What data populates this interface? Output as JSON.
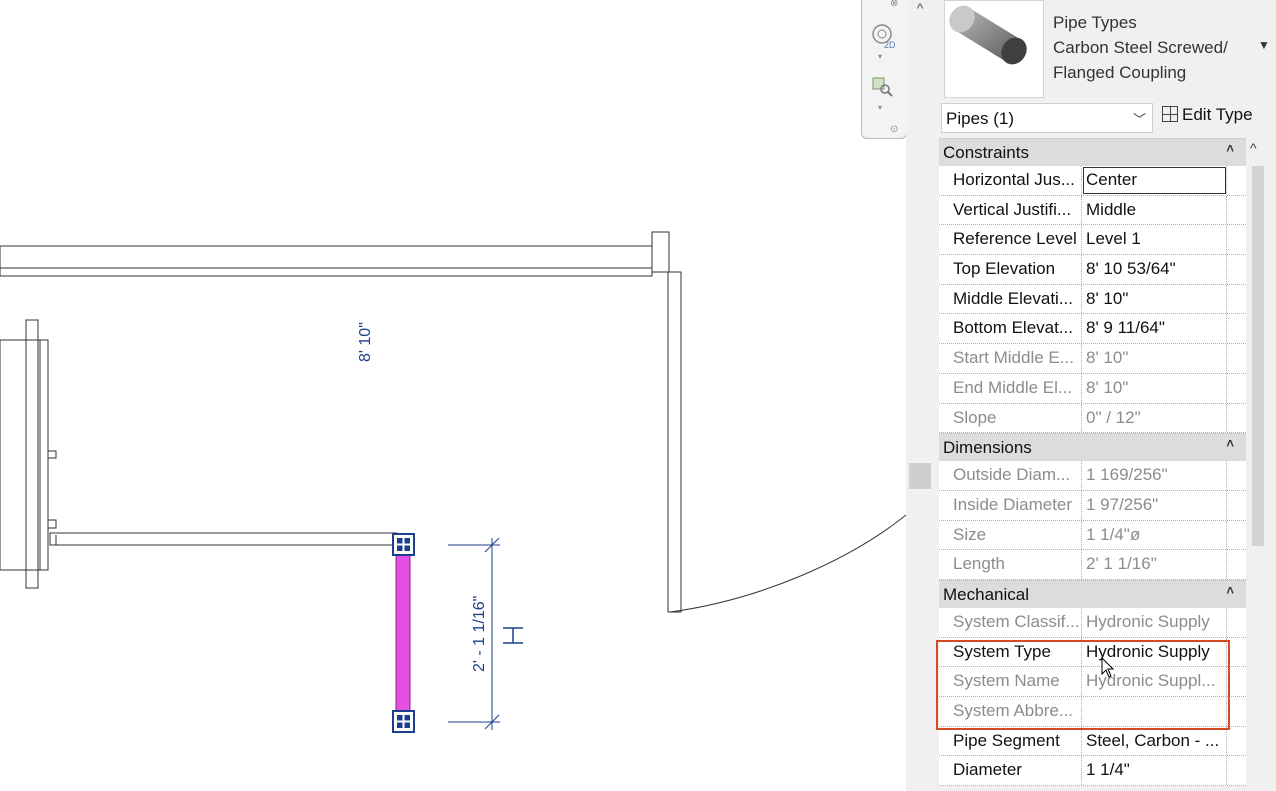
{
  "canvas": {
    "elevation_tag": "8' 10\"",
    "pipe_length_dimension": "2' - 1 1/16\"",
    "pipe_color": "#e64fe3",
    "view_bar_icons": [
      "2d-steering-wheel-icon",
      "zoom-region-icon"
    ]
  },
  "type_selector": {
    "line1": "Pipe Types",
    "line2": "Carbon Steel Screwed/",
    "line3": "Flanged Coupling",
    "instance_filter": "Pipes (1)",
    "edit_type_label": "Edit Type"
  },
  "groups": {
    "constraints": {
      "label": "Constraints",
      "rows": [
        {
          "key": "Horizontal Jus...",
          "value": "Center"
        },
        {
          "key": "Vertical Justifi...",
          "value": "Middle"
        },
        {
          "key": "Reference Level",
          "value": "Level 1"
        },
        {
          "key": "Top Elevation",
          "value": "8'  10 53/64\""
        },
        {
          "key": "Middle Elevati...",
          "value": "8'  10\""
        },
        {
          "key": "Bottom Elevat...",
          "value": "8'  9 11/64\""
        },
        {
          "key": "Start Middle E...",
          "value": "8'  10\""
        },
        {
          "key": "End Middle El...",
          "value": "8'  10\""
        },
        {
          "key": "Slope",
          "value": "0\" / 12\""
        }
      ]
    },
    "dimensions": {
      "label": "Dimensions",
      "rows": [
        {
          "key": "Outside Diam...",
          "value": "1 169/256\""
        },
        {
          "key": "Inside Diameter",
          "value": "1 97/256\""
        },
        {
          "key": "Size",
          "value": "1 1/4\"ø"
        },
        {
          "key": "Length",
          "value": "2'  1 1/16\""
        }
      ]
    },
    "mechanical": {
      "label": "Mechanical",
      "rows": [
        {
          "key": "System Classif...",
          "value": "Hydronic Supply"
        },
        {
          "key": "System Type",
          "value": "Hydronic Supply"
        },
        {
          "key": "System Name",
          "value": "Hydronic Suppl..."
        },
        {
          "key": "System Abbre...",
          "value": ""
        },
        {
          "key": "Pipe Segment",
          "value": "Steel, Carbon - ..."
        },
        {
          "key": "Diameter",
          "value": "1 1/4\""
        }
      ]
    }
  },
  "highlight_color": "#d64a22"
}
